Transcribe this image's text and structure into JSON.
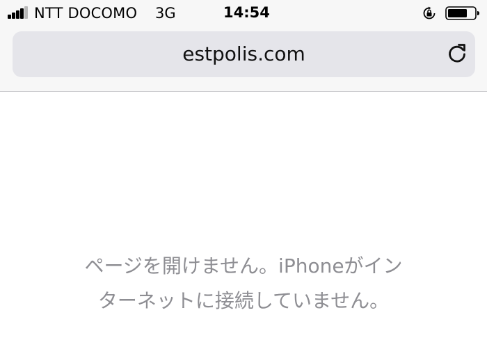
{
  "status_bar": {
    "carrier": "NTT DOCOMO",
    "network": "3G",
    "time": "14:54",
    "signal_bars_filled": 4,
    "signal_bars_total": 5,
    "icons": [
      "signal-strength-icon",
      "orientation-lock-icon",
      "battery-icon"
    ]
  },
  "browser": {
    "url": "estpolis.com",
    "reload_icon": "reload-icon"
  },
  "error": {
    "line1": "ページを開けません。iPhoneがイン",
    "line2": "ターネットに接続していません。"
  },
  "colors": {
    "chrome_bg": "#f7f7f7",
    "address_bar_bg": "#e5e5ea",
    "error_text": "#8e8e93"
  }
}
